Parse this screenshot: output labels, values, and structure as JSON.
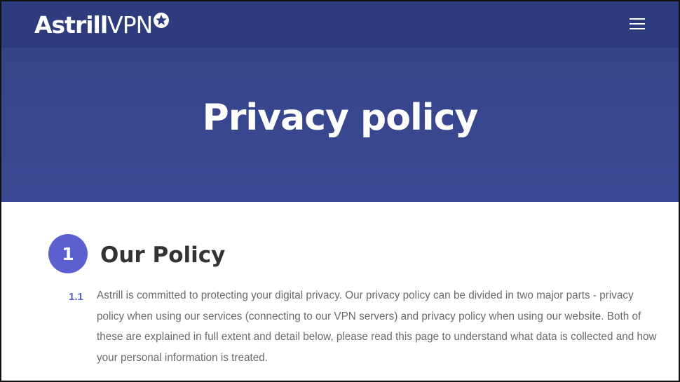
{
  "header": {
    "logo": {
      "bold": "Astrill",
      "regular": "VPN"
    },
    "menu_icon": "hamburger-menu-icon"
  },
  "hero": {
    "title": "Privacy policy"
  },
  "section": {
    "number": "1",
    "title": "Our Policy",
    "paragraph": {
      "number": "1.1",
      "text": "Astrill is committed to protecting your digital privacy. Our privacy policy can be divided in two major parts - privacy policy when using our services (connecting to our VPN servers) and privacy policy when using our website. Both of these are explained in full extent and detail below, please read this page to understand what data is collected and how your personal information is treated."
    }
  },
  "colors": {
    "header_bg": "#2e3b7c",
    "hero_bg": "#3a4a94",
    "accent": "#5b5fcf",
    "body_text": "#6a6a6a",
    "heading_text": "#333333"
  }
}
